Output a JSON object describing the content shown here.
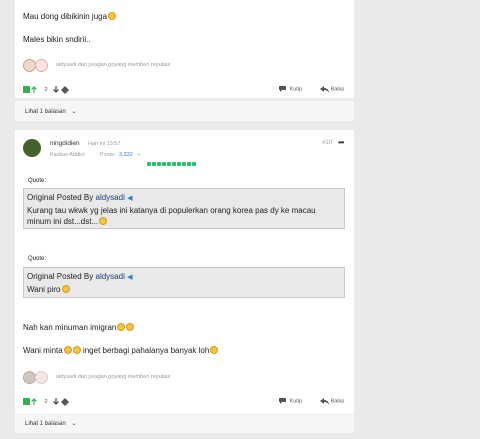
{
  "post1": {
    "text_line1": "Mau dong dibikinin juga",
    "text_line2": "Males bikin sndirii..",
    "reactions_text": "aldysadi dan juragan.goyang memberi reputasi",
    "vote_count": "2",
    "quote_button": "Kutip",
    "reply_button": "Balas",
    "show_replies": "Lihat 1 balasan"
  },
  "post2": {
    "username": "ningdidien",
    "time": "Hari ini 13:57",
    "post_number": "#10",
    "rank": "Kaskus Addict",
    "posts_label": "Posts:",
    "posts_count": "3,332",
    "quote1": {
      "label": "Quote:",
      "posted_by": "Original Posted By",
      "author": "aldysadi",
      "line1": "Kurang tau wkwk yg jelas ini katanya di populerkan orang korea pas dy ke macau",
      "line2": "minum ini dst...dst..."
    },
    "quote2": {
      "label": "Quote:",
      "posted_by": "Original Posted By",
      "author": "aldysadi",
      "line1": "Wani piro"
    },
    "text_line1": "Nah kan minuman imigran",
    "text_line2a": "Wani minta",
    "text_line2b": "inget berbagi pahalanya banyak loh",
    "reactions_text": "aldysadi dan juragan.goyang memberi reputasi",
    "vote_count": "2",
    "quote_button": "Kutip",
    "reply_button": "Balas",
    "show_replies": "Lihat 1 balasan"
  },
  "colors": {
    "background": "#e9eaec",
    "card": "#ffffff",
    "quote_box": "#e9e9ea",
    "link_blue": "#3b7cc9",
    "reputation_green": "#23c16b",
    "upvote_green": "#2fb24a"
  },
  "icons": [
    "upvote-arrow-icon",
    "downvote-arrow-icon",
    "gift-icon",
    "quote-icon",
    "reply-icon",
    "chevron-down-icon",
    "more-dots-icon",
    "emoji-icon"
  ]
}
